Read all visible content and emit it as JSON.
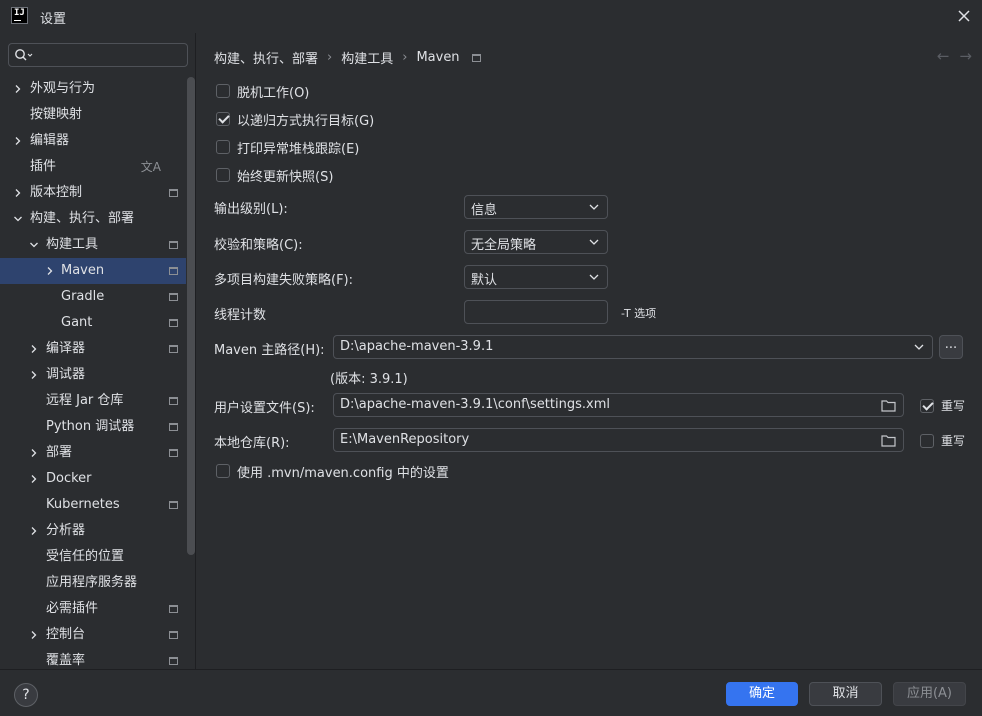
{
  "window": {
    "title": "设置",
    "logo": "IJ"
  },
  "search": {
    "placeholder": ""
  },
  "sidebar": {
    "items": [
      {
        "label": "外观与行为",
        "level": 0,
        "expandable": true,
        "expanded": false,
        "badge": false
      },
      {
        "label": "按键映射",
        "level": 0,
        "expandable": false,
        "badge": false
      },
      {
        "label": "编辑器",
        "level": 0,
        "expandable": true,
        "expanded": false,
        "badge": false
      },
      {
        "label": "插件",
        "level": 0,
        "expandable": false,
        "badge": false,
        "translate_icon": true
      },
      {
        "label": "版本控制",
        "level": 0,
        "expandable": true,
        "expanded": false,
        "badge": true
      },
      {
        "label": "构建、执行、部署",
        "level": 0,
        "expandable": true,
        "expanded": true,
        "badge": false
      },
      {
        "label": "构建工具",
        "level": 1,
        "expandable": true,
        "expanded": true,
        "badge": true
      },
      {
        "label": "Maven",
        "level": 2,
        "expandable": true,
        "expanded": false,
        "badge": true,
        "selected": true
      },
      {
        "label": "Gradle",
        "level": 2,
        "expandable": false,
        "badge": true
      },
      {
        "label": "Gant",
        "level": 2,
        "expandable": false,
        "badge": true
      },
      {
        "label": "编译器",
        "level": 1,
        "expandable": true,
        "expanded": false,
        "badge": true
      },
      {
        "label": "调试器",
        "level": 1,
        "expandable": true,
        "expanded": false,
        "badge": false
      },
      {
        "label": "远程 Jar 仓库",
        "level": 1,
        "expandable": false,
        "badge": true
      },
      {
        "label": "Python 调试器",
        "level": 1,
        "expandable": false,
        "badge": true
      },
      {
        "label": "部署",
        "level": 1,
        "expandable": true,
        "expanded": false,
        "badge": true
      },
      {
        "label": "Docker",
        "level": 1,
        "expandable": true,
        "expanded": false,
        "badge": false
      },
      {
        "label": "Kubernetes",
        "level": 1,
        "expandable": false,
        "badge": true
      },
      {
        "label": "分析器",
        "level": 1,
        "expandable": true,
        "expanded": false,
        "badge": false
      },
      {
        "label": "受信任的位置",
        "level": 1,
        "expandable": false,
        "badge": false
      },
      {
        "label": "应用程序服务器",
        "level": 1,
        "expandable": false,
        "badge": false
      },
      {
        "label": "必需插件",
        "level": 1,
        "expandable": false,
        "badge": true
      },
      {
        "label": "控制台",
        "level": 1,
        "expandable": true,
        "expanded": false,
        "badge": true
      },
      {
        "label": "覆盖率",
        "level": 1,
        "expandable": false,
        "badge": true
      }
    ]
  },
  "breadcrumb": {
    "items": [
      "构建、执行、部署",
      "构建工具",
      "Maven"
    ],
    "separator": "›"
  },
  "nav": {
    "back": "←",
    "forward": "→"
  },
  "checkboxes": [
    {
      "label": "脱机工作(O)",
      "checked": false
    },
    {
      "label": "以递归方式执行目标(G)",
      "checked": true
    },
    {
      "label": "打印异常堆栈跟踪(E)",
      "checked": false
    },
    {
      "label": "始终更新快照(S)",
      "checked": false
    }
  ],
  "form": {
    "output_level": {
      "label": "输出级别(L):",
      "value": "信息"
    },
    "checksum_policy": {
      "label": "校验和策略(C):",
      "value": "无全局策略"
    },
    "multiproject_fail": {
      "label": "多项目构建失败策略(F):",
      "value": "默认"
    },
    "thread_count": {
      "label": "线程计数",
      "value": "",
      "hint": "-T 选项"
    },
    "maven_home": {
      "label": "Maven 主路径(H):",
      "value": "D:\\apache-maven-3.9.1",
      "browse": "...",
      "version": "(版本: 3.9.1)"
    },
    "user_settings": {
      "label": "用户设置文件(S):",
      "value": "D:\\apache-maven-3.9.1\\conf\\settings.xml",
      "override_label": "重写",
      "override_checked": true
    },
    "local_repo": {
      "label": "本地仓库(R):",
      "value": "E:\\MavenRepository",
      "override_label": "重写",
      "override_checked": false
    },
    "use_mvn_config": {
      "label": "使用 .mvn/maven.config 中的设置",
      "checked": false
    }
  },
  "footer": {
    "help": "?",
    "ok": "确定",
    "cancel": "取消",
    "apply": "应用(A)"
  },
  "colors": {
    "accent": "#3574f0",
    "selection": "#2e436e",
    "background": "#2b2d30",
    "text": "#dfe1e5"
  }
}
